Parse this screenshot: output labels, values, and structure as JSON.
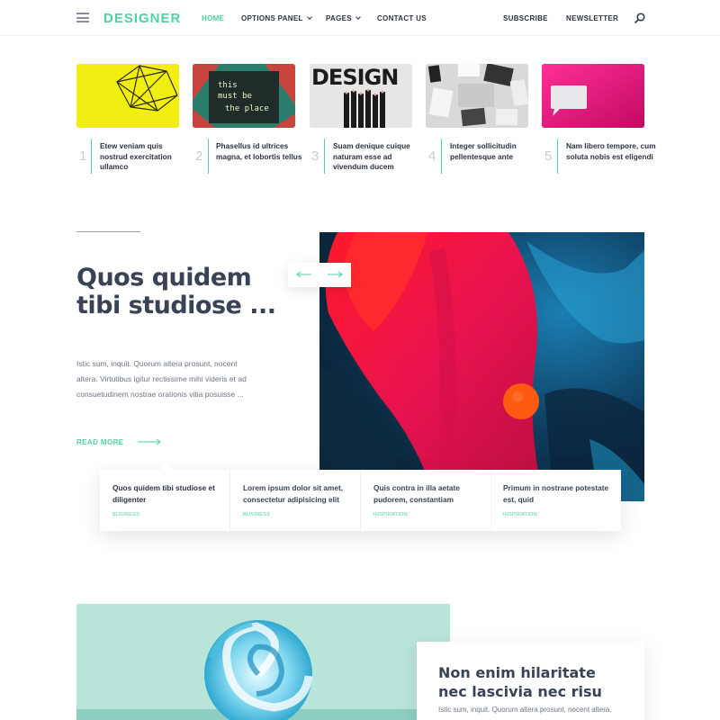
{
  "header": {
    "logo": "DESIGNER",
    "nav": [
      {
        "label": "HOME",
        "active": true
      },
      {
        "label": "OPTIONS PANEL",
        "dropdown": true
      },
      {
        "label": "PAGES",
        "dropdown": true
      },
      {
        "label": "CONTACT US"
      }
    ],
    "right_nav": [
      "SUBSCRIBE",
      "NEWSLETTER"
    ],
    "icons": {
      "menu": "hamburger-icon",
      "search": "search-icon"
    }
  },
  "featured": [
    {
      "number": "1",
      "title": "Etew veniam quis nostrud exercitation ullamco",
      "image": "yellow-geometric-lamp"
    },
    {
      "number": "2",
      "title": "Phasellus id ultrices magna, et lobortis tellus",
      "image": "this-must-be-the-place-sign"
    },
    {
      "number": "3",
      "title": "Suam denique cuique naturam esse ad vivendum ducem",
      "image": "design-pencils"
    },
    {
      "number": "4",
      "title": "Integer sollicitudin pellentesque ante",
      "image": "desk-flatlay"
    },
    {
      "number": "5",
      "title": "Nam libero tempore, cum soluta nobis est eligendi",
      "image": "pink-speech-bubble"
    }
  ],
  "hero": {
    "title": "Quos quidem tibi studiose ...",
    "text": "Istic sum, inquit. Quorum altera prosunt, nocent altera. Virtutibus igitur rectissime mihi videris et ad consuetudinem nostrae orationis vitia posuisse ...",
    "read_more": "READ MORE",
    "image": "abstract-red-blue-paint"
  },
  "cards": [
    {
      "title": "Quos quidem tibi studiose et diligenter",
      "tag": "BUSINESS"
    },
    {
      "title": "Lorem ipsum dolor sit amet, consectetur adipisicing elit",
      "tag": "BUSINESS"
    },
    {
      "title": "Quis contra in illa aetate pudorem, constantiam",
      "tag": "INSPIRATION"
    },
    {
      "title": "Primum in nostrane potestate est, quid",
      "tag": "INSPIRATION"
    }
  ],
  "feature": {
    "title": "Non enim hilaritate nec lascivia nec risu",
    "text": "Istic sum, inquit. Quorum altera prosunt, nocent altera.",
    "image": "swirl-lollipop"
  },
  "colors": {
    "accent": "#4fd1a5",
    "heading": "#3a4256",
    "text": "#6f7683"
  }
}
